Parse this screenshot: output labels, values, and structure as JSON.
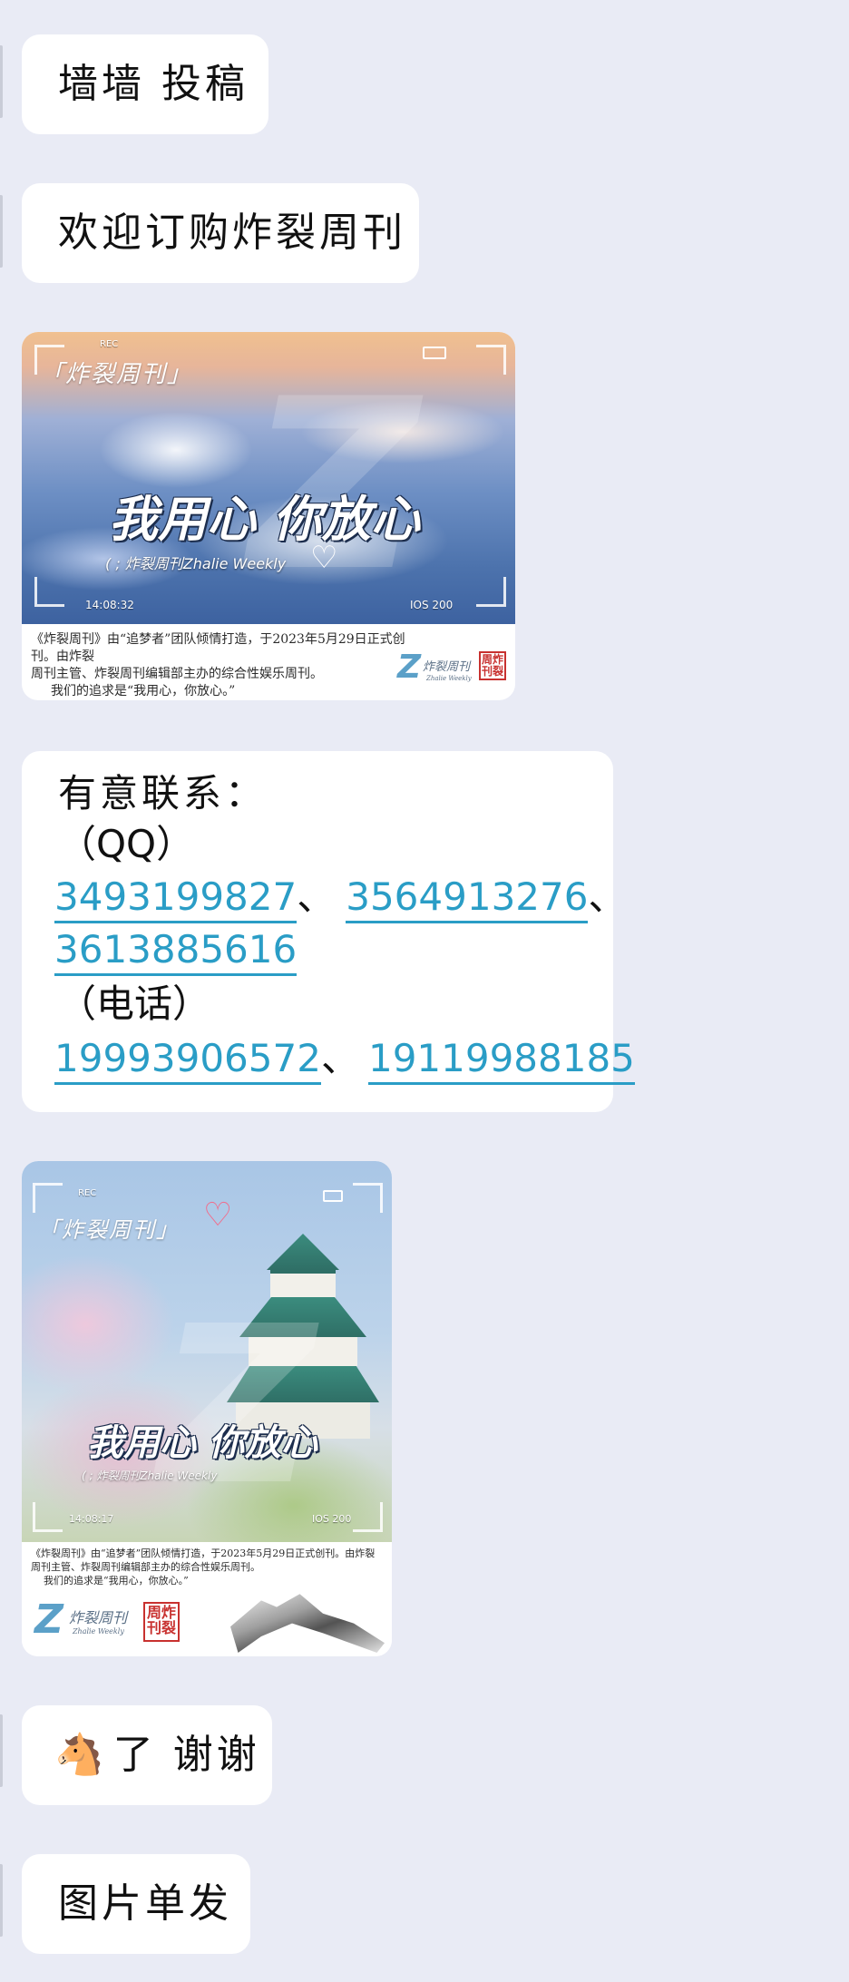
{
  "messages": [
    {
      "type": "text",
      "text": "墙墙 投稿"
    },
    {
      "type": "text",
      "text": "欢迎订购炸裂周刊"
    },
    {
      "type": "image",
      "brand": "「炸裂周刊」",
      "rec": "REC",
      "slogan": "我用心 你放心",
      "sub": "( ; 炸裂周刊Zhalie Weekly",
      "time": "14:08:32",
      "ios": "IOS 200",
      "caption_line1": "《炸裂周刊》由“追梦者”团队倾情打造，于2023年5月29日正式创刊。由炸裂",
      "caption_line2": "周刊主管、炸裂周刊编辑部主办的综合性娱乐周刊。",
      "caption_line3": "我们的追求是“我用心，你放心。”",
      "logo_name": "炸裂周刊",
      "logo_sub": "Zhalie Weekly",
      "stamp": "周炸刊裂"
    },
    {
      "type": "contact",
      "heading": "有意联系：",
      "qq_label": "（QQ）",
      "qq": [
        "3493199827",
        "3564913276",
        "3613885616"
      ],
      "phone_label": "（电话）",
      "phones": [
        "19993906572",
        "19119988185"
      ],
      "separator": "、"
    },
    {
      "type": "image",
      "brand": "「炸裂周刊」",
      "rec": "REC",
      "slogan": "我用心 你放心",
      "sub": "( ; 炸裂周刊Zhalie Weekly",
      "time": "14:08:17",
      "ios": "IOS 200",
      "caption_line1": "《炸裂周刊》由“追梦者”团队倾情打造，于2023年5月29日正式创刊。由炸裂",
      "caption_line2": "周刊主管、炸裂周刊编辑部主办的综合性娱乐周刊。",
      "caption_line3": "我们的追求是“我用心，你放心。”",
      "logo_name": "炸裂周刊",
      "logo_sub": "Zhalie Weekly",
      "stamp": "周炸刊裂"
    },
    {
      "type": "text",
      "emoji": "🐴",
      "text": "了 谢谢"
    },
    {
      "type": "text",
      "text": "图片单发"
    }
  ]
}
